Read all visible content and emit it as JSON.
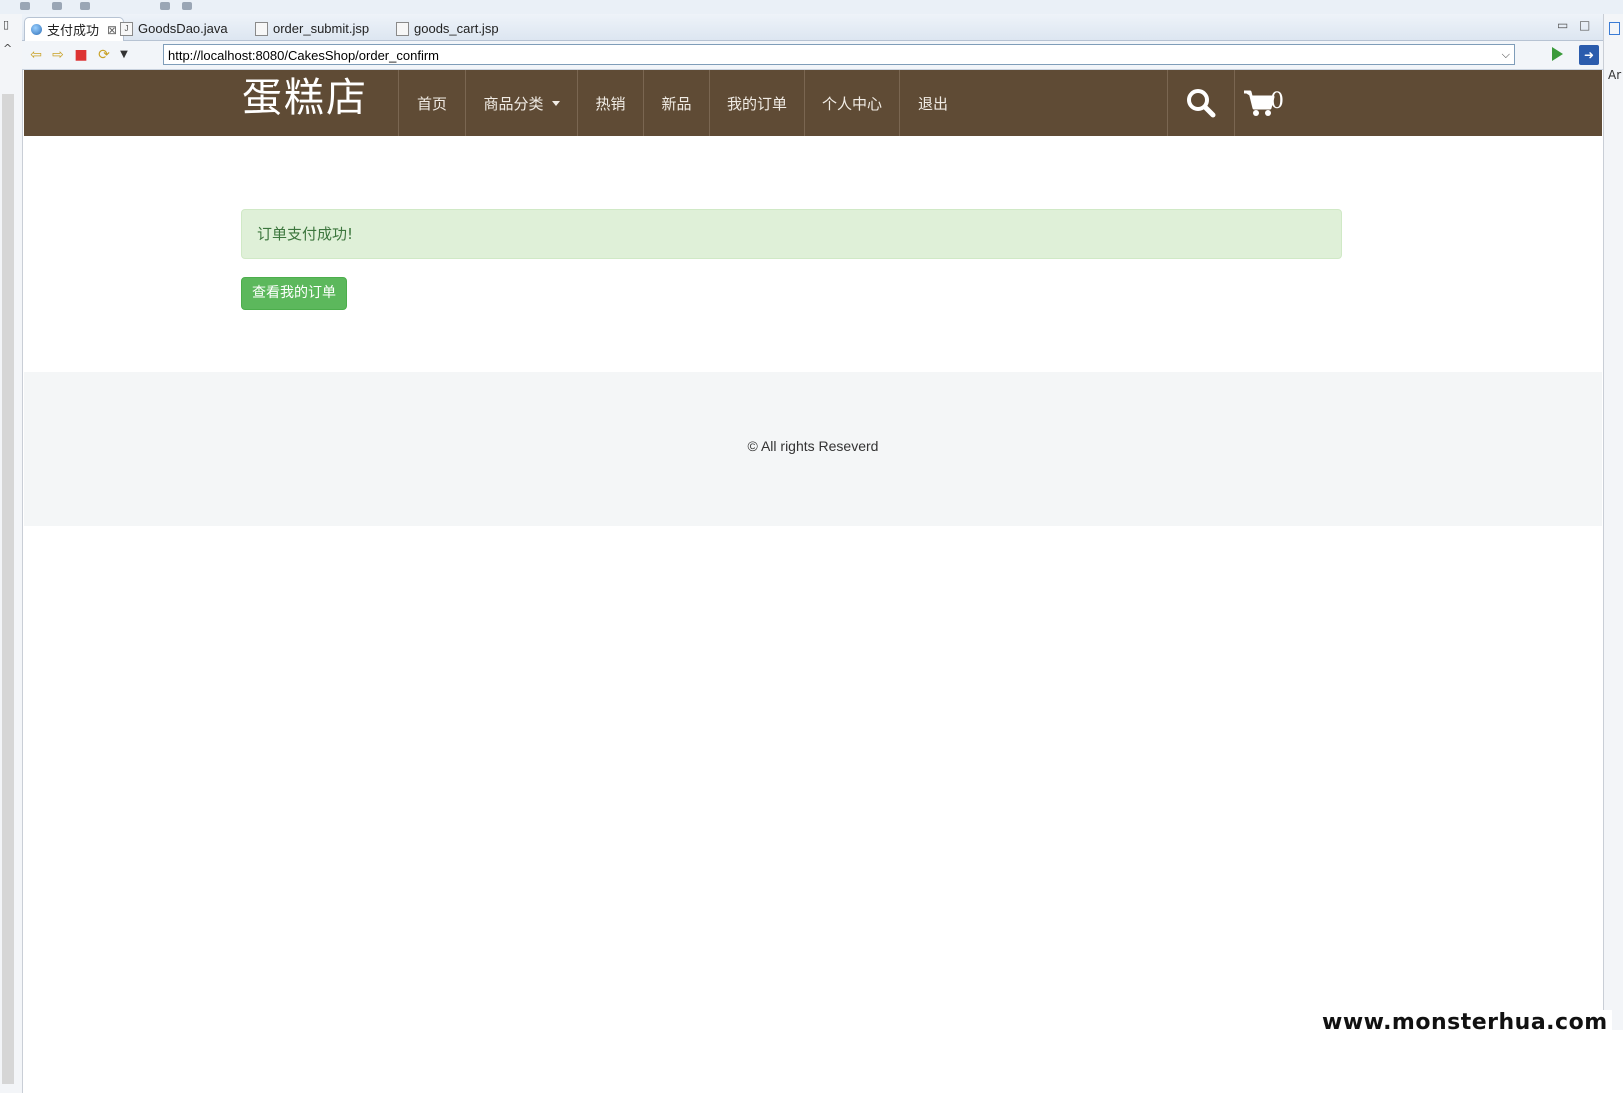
{
  "ide": {
    "tabs": [
      {
        "label": "支付成功",
        "icon": "globe-icon",
        "active": true
      },
      {
        "label": "GoodsDao.java",
        "icon": "java-file-icon"
      },
      {
        "label": "order_submit.jsp",
        "icon": "jsp-file-icon"
      },
      {
        "label": "goods_cart.jsp",
        "icon": "jsp-file-icon"
      }
    ],
    "url": "http://localhost:8080/CakesShop/order_confirm",
    "right_strip_text": "Ar"
  },
  "site": {
    "brand": "蛋糕店",
    "nav": [
      "首页",
      "商品分类",
      "热销",
      "新品",
      "我的订单",
      "个人中心",
      "退出"
    ],
    "cart_count": "0",
    "alert": "订单支付成功!",
    "button": "查看我的订单",
    "footer": "© All rights Reseverd"
  },
  "watermark": "www.monsterhua.com",
  "colors": {
    "header_bg": "#5f4b35",
    "alert_bg": "#dff0d8",
    "alert_text": "#3c763d",
    "button_bg": "#5cb85c",
    "footer_bg": "#f4f6f7"
  }
}
